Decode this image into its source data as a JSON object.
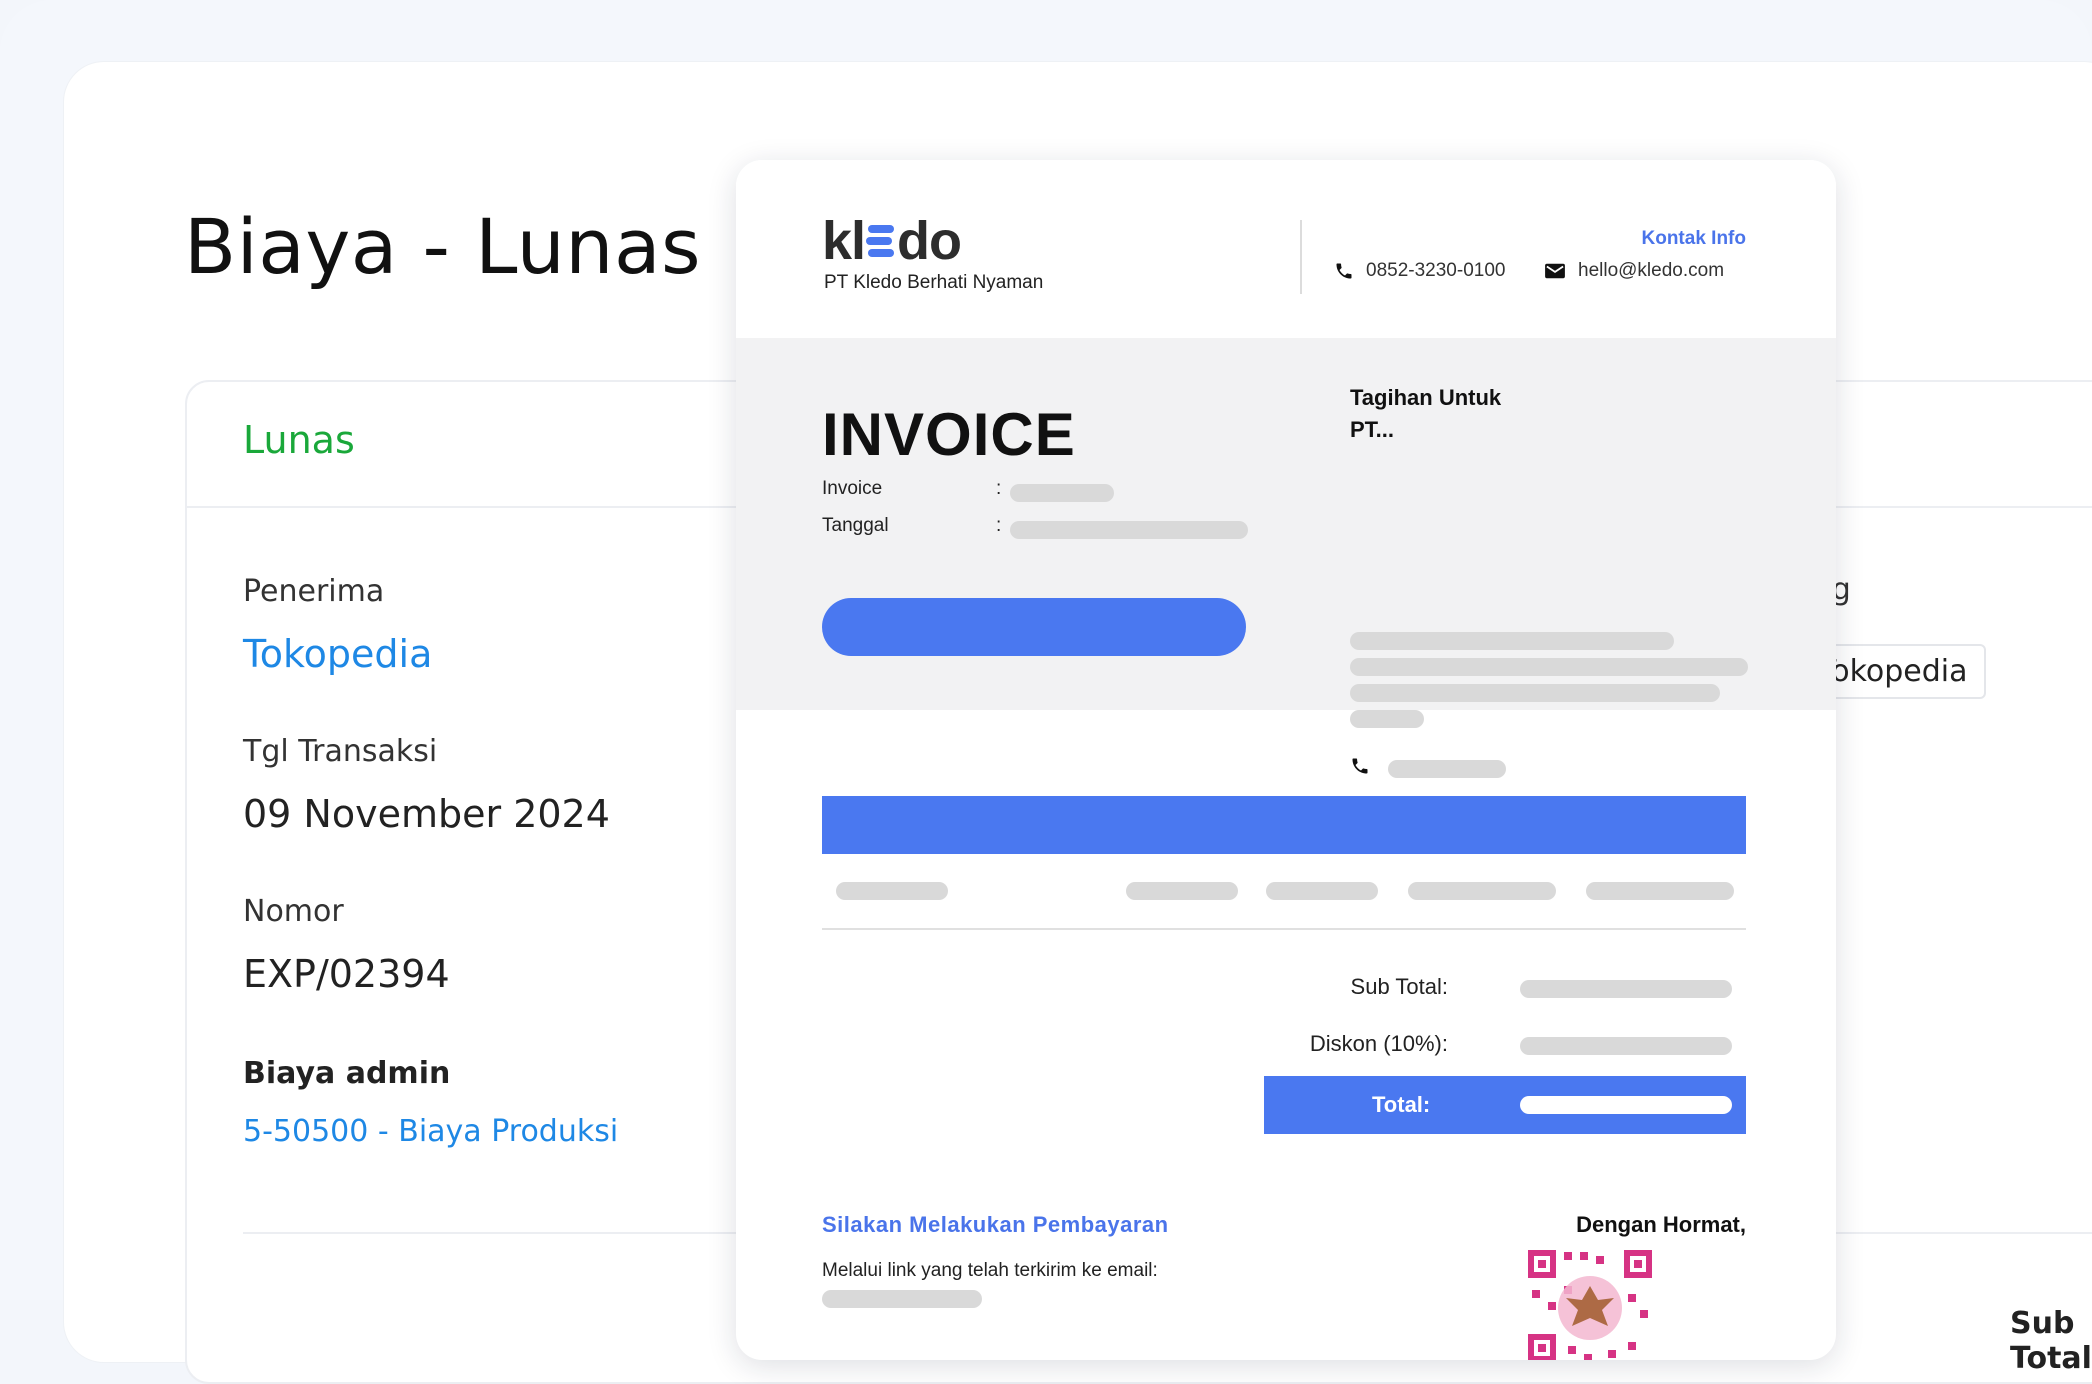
{
  "page": {
    "title": "Biaya - Lunas"
  },
  "detail": {
    "status": "Lunas",
    "recipient_label": "Penerima",
    "recipient_value": "Tokopedia",
    "date_label": "Tgl Transaksi",
    "date_value": "09 November 2024",
    "number_label": "Nomor",
    "number_value": "EXP/02394",
    "expense_label": "Biaya admin",
    "expense_value": "5-50500 - Biaya Produksi",
    "tag_label": "Tag",
    "tag_value": "Tokopedia",
    "subtotal_label": "Sub Total"
  },
  "invoice": {
    "logo": {
      "prefix": "kl",
      "suffix": "do"
    },
    "company": "PT Kledo Berhati Nyaman",
    "contact_title": "Kontak Info",
    "phone": "0852-3230-0100",
    "email": "hello@kledo.com",
    "title": "INVOICE",
    "invoice_label": "Invoice",
    "date_label": "Tanggal",
    "colon": ":",
    "bill_to_title": "Tagihan Untuk",
    "bill_to_name": "PT...",
    "subtotal_label": "Sub Total:",
    "discount_label": "Diskon (10%):",
    "total_label": "Total:",
    "payment_title": "Silakan Melakukan Pembayaran",
    "payment_note": "Melalui link yang telah terkirim ke email:",
    "regards": "Dengan Hormat,"
  },
  "colors": {
    "accent": "#4a78f0",
    "status_green": "#1aa83a",
    "link_blue": "#1e88e5",
    "placeholder": "#d9d9d9"
  },
  "icons": [
    "phone-icon",
    "mail-icon",
    "qr-stamp-icon"
  ]
}
